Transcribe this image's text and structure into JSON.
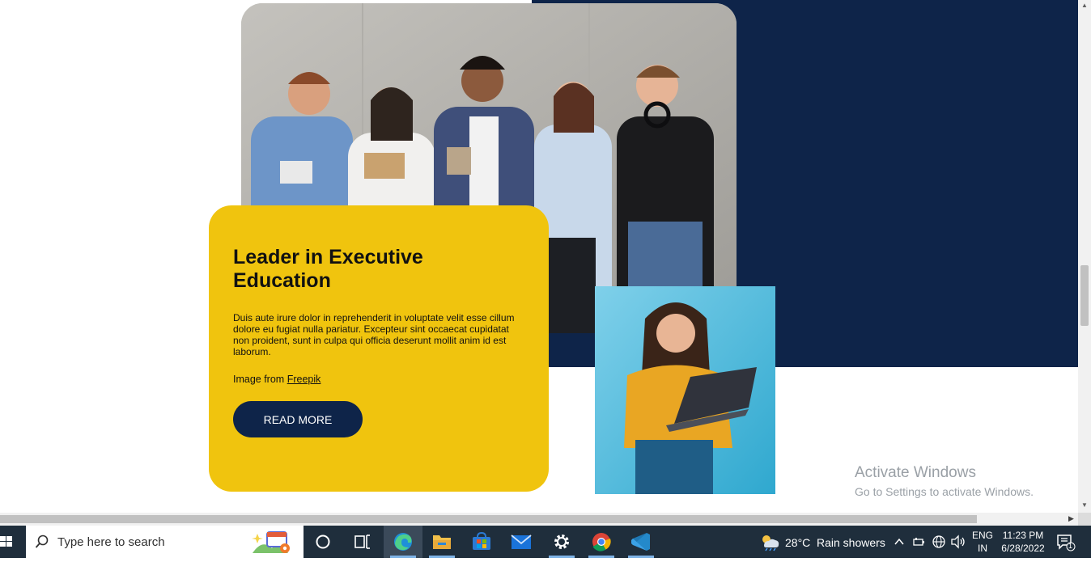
{
  "card": {
    "title": "Leader in Executive Education",
    "body": "Duis aute irure dolor in reprehenderit in voluptate velit esse cillum dolore eu fugiat nulla pariatur. Excepteur sint occaecat cupidatat non proident, sunt in culpa qui officia deserunt mollit anim id est laborum.",
    "credit_prefix": "Image from ",
    "credit_link": "Freepik",
    "button_label": "READ MORE"
  },
  "watermark": {
    "line1": "Activate Windows",
    "line2": "Go to Settings to activate Windows."
  },
  "taskbar": {
    "search_placeholder": "Type here to search",
    "weather_temp": "28°C",
    "weather_desc": "Rain showers",
    "lang_line1": "ENG",
    "lang_line2": "IN",
    "time": "11:23 PM",
    "date": "6/28/2022",
    "notification_count": "1"
  },
  "colors": {
    "navy": "#0e2449",
    "yellow": "#f0c40e",
    "taskbar": "#1f2e3c"
  }
}
